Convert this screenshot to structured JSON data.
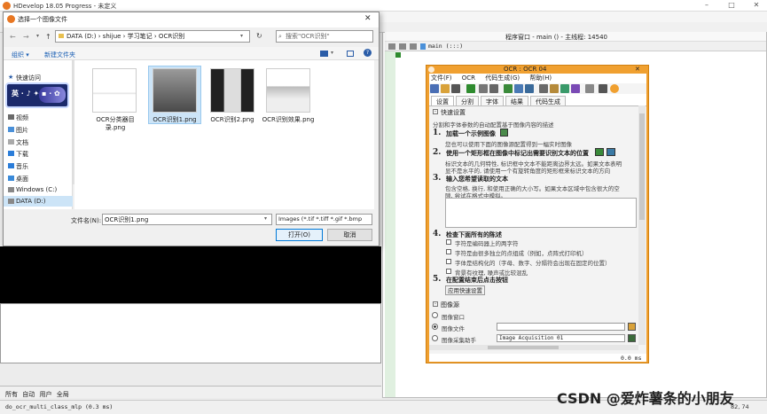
{
  "app": {
    "title": "HDevelop 18.05 Progress - 未定义"
  },
  "program": {
    "window_title": "程序窗口 - main () - 主线程: 14540",
    "proc_selector": "main (:::)"
  },
  "dialog": {
    "title": "选择一个图像文件",
    "address": "DATA (D:)  ›  shijue  ›  学习笔记  ›  OCR识别",
    "search_placeholder": "搜索\"OCR识别\"",
    "organize": "组织 ▾",
    "new_folder": "新建文件夹",
    "nav": [
      "快速访问",
      "视频",
      "图片",
      "文档",
      "下载",
      "音乐",
      "桌面",
      "Windows (C:)",
      "DATA (D:)"
    ],
    "files": [
      {
        "name": "OCR分类器目录.png"
      },
      {
        "name": "OCR识别1.png"
      },
      {
        "name": "OCR识别2.png"
      },
      {
        "name": "OCR识别效果.png"
      }
    ],
    "filename_label": "文件名(N):",
    "filename_value": "OCR识别1.png",
    "filter": "Images (*.tif *.tiff *.gif *.bmp",
    "open": "打开(O)",
    "cancel": "取消"
  },
  "baidu_badge": {
    "text": "英 · ♪ ✦ ▪ · ✿"
  },
  "ocr": {
    "title": "OCR : OCR 04",
    "menu": [
      "文件(F)",
      "OCR",
      "代码生成(G)",
      "帮助(H)"
    ],
    "tabs": [
      "设置",
      "分割",
      "字体",
      "结果",
      "代码生成"
    ],
    "section_quick": "快速设置",
    "intro": "分割和字体参数的自动配置基于图像内容的描述",
    "step1_num": "1.",
    "step1": "加载一个示例图像",
    "step1_desc": "您也可以使用下面的图像源配置得到一幅实时图像",
    "step2_num": "2.",
    "step2": "使用一个矩形框在图像中标记出需要识别文本的位置",
    "step2_desc1": "标识文本的几何特性, 标识框中文本不能距离边界太远。如果文本表明",
    "step2_desc2": "显不是水平的, 请使用一个有旋转角度的矩形框来标识文本的方向",
    "step3_num": "3.",
    "step3": "输入您希望读取的文本",
    "step3_desc1": "包含空格, 换行, 和使用正确的大小写。如果文本区域中包含很大的空",
    "step3_desc2": "隙, 尝试在格式中模拟。",
    "step4_num": "4.",
    "step4": "检查下面所有的陈述",
    "checks": [
      "字符是编码器上的两字符",
      "字符是由很多独立的点组成（例如，点阵式打印机）",
      "字体是结构化的（字母、数字、分隔符会出现在固定的位置）",
      "背景有纹理, 噪声或比较混乱"
    ],
    "step5_num": "5.",
    "step5": "在配置结束后点击按钮",
    "apply": "应用快速设置",
    "section_source": "图像源",
    "source_window": "图像窗口",
    "source_file": "图像文件",
    "source_acq": "图像采集助手",
    "acq_value": "Image Acquisition 01",
    "time": "0.0 ms"
  },
  "var_tabs": [
    "所有",
    "自动",
    "用户",
    "全局"
  ],
  "status": {
    "text": "do_ocr_multi_class_mlp (0.3 ms)",
    "coords": "82, 74"
  },
  "watermark": "CSDN @爱炸薯条的小朋友"
}
